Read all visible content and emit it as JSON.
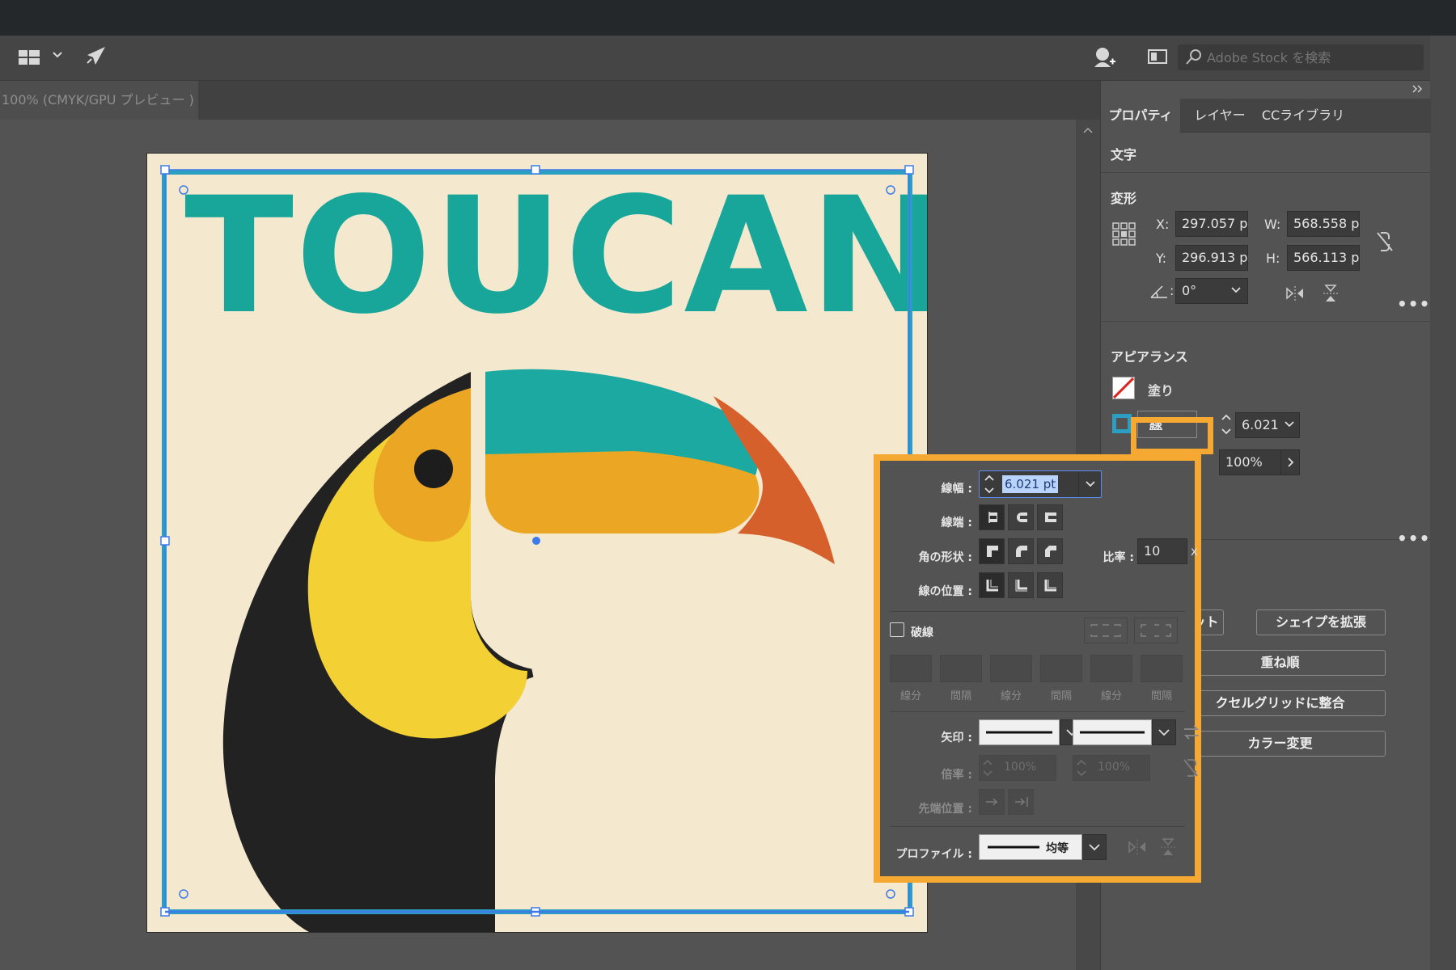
{
  "toolbar": {
    "workspace_icon": "grid-layout-icon",
    "share_icon": "rocket-send-icon",
    "search_placeholder": "Adobe Stock を検索"
  },
  "document": {
    "tab_label": "100% (CMYK/GPU プレビュー )",
    "artwork_title": "TOUCAN"
  },
  "panel": {
    "tabs": [
      "プロパティ",
      "レイヤー",
      "CCライブラリ"
    ],
    "active_tab": "プロパティ",
    "section_text": "文字",
    "transform": {
      "title": "変形",
      "x_label": "X:",
      "x_value": "297.057 p",
      "y_label": "Y:",
      "y_value": "296.913 p",
      "w_label": "W:",
      "w_value": "568.558 p",
      "h_label": "H:",
      "h_value": "566.113 p",
      "angle_label": ":",
      "angle_value": "0°"
    },
    "appearance": {
      "title": "アピアランス",
      "fill_label": "塗り",
      "stroke_label": "線",
      "stroke_value": "6.021",
      "opacity_value": "100%"
    },
    "quick_actions": {
      "offset_label": "セット",
      "expand_label": "シェイプを拡張",
      "arrange_label": "重ね順",
      "pixel_grid_label": "クセルグリッドに整合",
      "recolor_label": "カラー変更"
    }
  },
  "stroke_popup": {
    "weight_label": "線幅 :",
    "weight_value": "6.021 pt",
    "cap_label": "線端 :",
    "corner_label": "角の形状 :",
    "limit_label": "比率 :",
    "limit_value": "10",
    "limit_unit": "x",
    "align_label": "線の位置 :",
    "dashed_label": "破線",
    "dashed_checked": false,
    "dash_labels": [
      "線分",
      "間隔",
      "線分",
      "間隔",
      "線分",
      "間隔"
    ],
    "arrow_label": "矢印 :",
    "scale_label": "倍率 :",
    "scale_start": "100%",
    "scale_end": "100%",
    "tip_label": "先端位置 :",
    "profile_label": "プロファイル :",
    "profile_value": "均等"
  },
  "colors": {
    "accent_highlight": "#f5a933",
    "teal": "#17a699",
    "selection_blue": "#3d7bea",
    "bounding_teal": "#2b9fc2"
  }
}
